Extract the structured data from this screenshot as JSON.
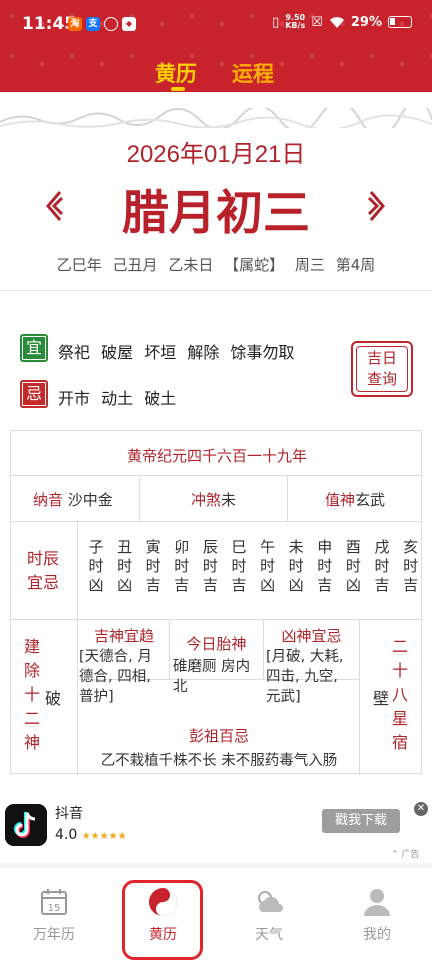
{
  "status_bar": {
    "time": "11:45",
    "net_speed_value": "9.50",
    "net_speed_unit": "KB/s",
    "battery": "29%"
  },
  "tabs": [
    {
      "label": "黄历",
      "active": true
    },
    {
      "label": "运程",
      "active": false
    }
  ],
  "date": {
    "gregorian": "2026年01月21日",
    "lunar": "腊月初三",
    "ganzhi_items": [
      "乙巳年",
      "己丑月",
      "乙未日",
      "【属蛇】",
      "周三",
      "第4周"
    ]
  },
  "yiji": {
    "yi_badge": "宜",
    "ji_badge": "忌",
    "yi_items": [
      "祭祀",
      "破屋",
      "坏垣",
      "解除",
      "馀事勿取"
    ],
    "ji_items": [
      "开市",
      "动土",
      "破土"
    ],
    "jiri_button": [
      "吉日",
      "查询"
    ]
  },
  "table": {
    "era": "黄帝纪元四千六百一十九年",
    "nayin_label": "纳音",
    "nayin_value": "沙中金",
    "chongsha_label": "冲煞",
    "chongsha_value": "未",
    "zhishen_label": "值神",
    "zhishen_value": "玄武",
    "shichen_label": [
      "时辰",
      "宜忌"
    ],
    "hours": [
      {
        "zhi": "子",
        "shi": "时",
        "luck": "凶"
      },
      {
        "zhi": "丑",
        "shi": "时",
        "luck": "凶"
      },
      {
        "zhi": "寅",
        "shi": "时",
        "luck": "吉"
      },
      {
        "zhi": "卯",
        "shi": "时",
        "luck": "吉"
      },
      {
        "zhi": "辰",
        "shi": "时",
        "luck": "吉"
      },
      {
        "zhi": "巳",
        "shi": "时",
        "luck": "吉"
      },
      {
        "zhi": "午",
        "shi": "时",
        "luck": "凶"
      },
      {
        "zhi": "未",
        "shi": "时",
        "luck": "凶"
      },
      {
        "zhi": "申",
        "shi": "时",
        "luck": "吉"
      },
      {
        "zhi": "酉",
        "shi": "时",
        "luck": "凶"
      },
      {
        "zhi": "戌",
        "shi": "时",
        "luck": "吉"
      },
      {
        "zhi": "亥",
        "shi": "时",
        "luck": "吉"
      }
    ],
    "jianchu_label": [
      "建",
      "除",
      "十",
      "二",
      "神"
    ],
    "jianchu_value": "破",
    "jishen_title": "吉神宜趋",
    "jishen_lines": [
      "[天德合, 月",
      "德合, 四相,",
      "普护]"
    ],
    "taishen_title": "今日胎神",
    "taishen_lines": [
      "碓磨厕 房内",
      "北"
    ],
    "xiongshen_title": "凶神宜忌",
    "xiongshen_lines": [
      "[月破, 大耗,",
      "四击, 九空,",
      "元武]"
    ],
    "pengzu_title": "彭祖百忌",
    "pengzu_text": "乙不栽植千株不长 未不服药毒气入肠",
    "xiu_label": [
      "二",
      "十",
      "八",
      "星",
      "宿"
    ],
    "xiu_value": "壁"
  },
  "ad": {
    "app_name": "抖音",
    "rating": "4.0",
    "stars": "★★★★★",
    "button": "戳我下载",
    "tag": "广告"
  },
  "bottom_nav": [
    {
      "label": "万年历",
      "icon": "calendar-icon",
      "day": "15"
    },
    {
      "label": "黄历",
      "icon": "yinyang-icon"
    },
    {
      "label": "天气",
      "icon": "weather-icon"
    },
    {
      "label": "我的",
      "icon": "profile-icon"
    }
  ],
  "colors": {
    "header_red": "#c8232c",
    "title_red": "#b1242c",
    "tab_active": "#ffd100",
    "yi_green": "#2a8c3a",
    "ji_red": "#c42a2a"
  }
}
